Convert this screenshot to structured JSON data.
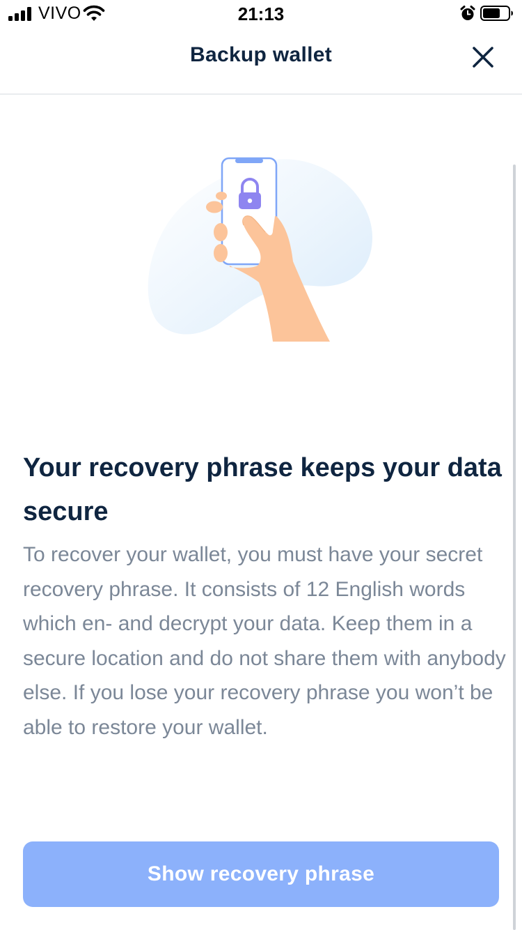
{
  "status_bar": {
    "carrier": "VIVO",
    "time": "21:13",
    "battery_level": 0.65,
    "icons": [
      "signal-icon",
      "wifi-icon",
      "alarm-icon",
      "battery-icon"
    ]
  },
  "nav": {
    "title": "Backup wallet",
    "close_icon": "close-icon"
  },
  "illustration": {
    "icon": "lock-icon",
    "description_icon": "phone-in-hand-icon"
  },
  "content": {
    "headline": "Your recovery phrase keeps your data secure",
    "body": "To recover your wallet, you must have your secret recovery phrase. It consists of 12 English words which en- and decrypt your data. Keep them in a secure location and do not share them with anybody else. If you lose your recovery phrase you won’t be able to restore your wallet."
  },
  "actions": {
    "primary_label": "Show recovery phrase"
  },
  "colors": {
    "primary": "#8cb1fb",
    "title": "#0f2540",
    "body": "#7b8797",
    "lock": "#8e85f0",
    "skin": "#fcc49a",
    "phone_frame": "#7fa6f7"
  }
}
